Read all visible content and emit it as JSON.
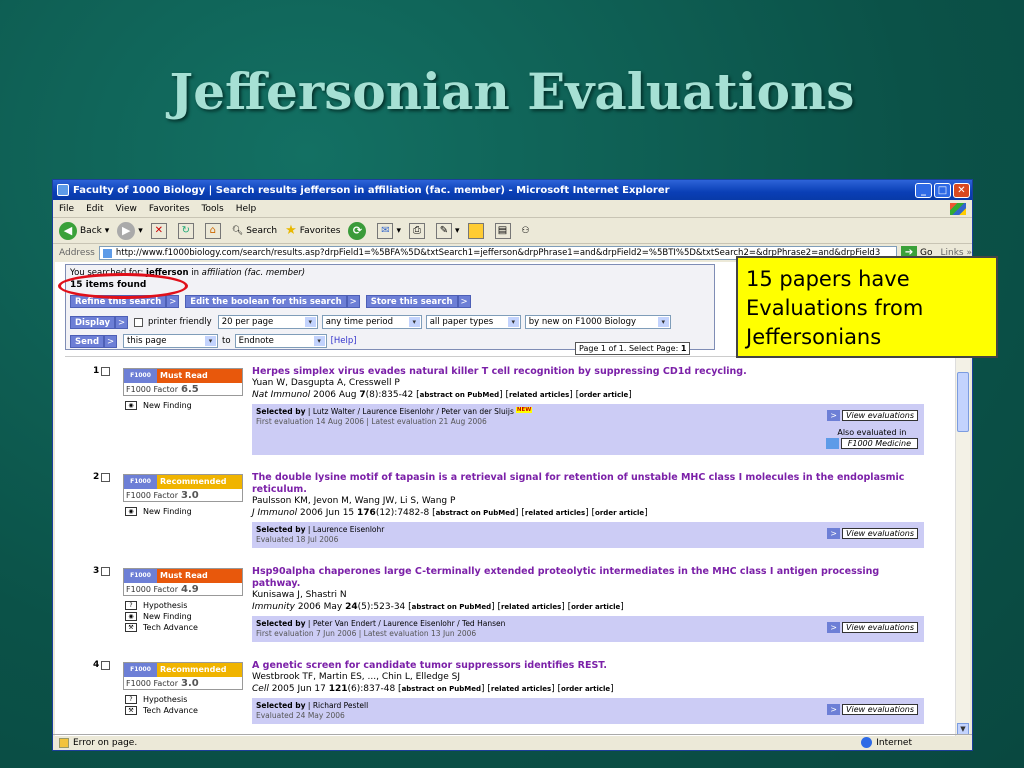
{
  "slide": {
    "title": "Jeffersonian Evaluations"
  },
  "callout": {
    "text": "15 papers have Evaluations from Jeffersonians"
  },
  "browser": {
    "title": "Faculty of 1000 Biology | Search results jefferson in affiliation (fac. member) - Microsoft Internet Explorer",
    "menu": [
      "File",
      "Edit",
      "View",
      "Favorites",
      "Tools",
      "Help"
    ],
    "toolbar": {
      "back": "Back",
      "search": "Search",
      "favorites": "Favorites"
    },
    "address_label": "Address",
    "url": "http://www.f1000biology.com/search/results.asp?drpField1=%5BFA%5D&txtSearch1=jefferson&drpPhrase1=and&drpField2=%5BTI%5D&txtSearch2=&drpPhrase2=and&drpField3",
    "go": "Go",
    "links": "Links",
    "status": "Error on page.",
    "zone": "Internet"
  },
  "search": {
    "searched_prefix": "You searched for:",
    "term": "jefferson",
    "in_word": "in",
    "scope": "affiliation (fac. member)",
    "found": "15 items found",
    "refine": "Refine this search",
    "edit_boolean": "Edit the boolean for this search",
    "store": "Store this search",
    "display_btn": "Display",
    "printer_friendly": "printer friendly",
    "per_page": "20 per page",
    "time_period": "any time period",
    "paper_types": "all paper types",
    "sort": "by new on F1000 Biology",
    "send_btn": "Send",
    "send_scope": "this page",
    "to_word": "to",
    "send_target": "Endnote",
    "help": "[Help]",
    "page_info": "Page 1 of 1. Select Page:",
    "page_num": "1"
  },
  "results": [
    {
      "num": "1",
      "rating": "Must Read",
      "rating_color": "#e8580c",
      "factor_label": "F1000 Factor",
      "factor": "6.5",
      "tags": [
        {
          "icon": "eye-icon",
          "label": "New Finding"
        }
      ],
      "title": "Herpes simplex virus evades natural killer T cell recognition by suppressing CD1d recycling.",
      "authors": "Yuan W, Dasgupta A, Cresswell P",
      "journal": "Nat Immunol",
      "citation_pre": "2006 Aug",
      "volume": "7",
      "citation_post": "(8):835-42",
      "selected_label": "Selected by",
      "selectors": "| Lutz Walter / Laurence Eisenlohr / Peter van der Sluijs",
      "eval_dates": "First evaluation 14 Aug 2006 | Latest evaluation 21 Aug 2006",
      "also_label": "Also evaluated in",
      "also_target": "F1000 Medicine"
    },
    {
      "num": "2",
      "rating": "Recommended",
      "rating_color": "#f0b400",
      "factor_label": "F1000 Factor",
      "factor": "3.0",
      "tags": [
        {
          "icon": "eye-icon",
          "label": "New Finding"
        }
      ],
      "title": "The double lysine motif of tapasin is a retrieval signal for retention of unstable MHC class I molecules in the endoplasmic reticulum.",
      "authors": "Paulsson KM, Jevon M, Wang JW, Li S, Wang P",
      "journal": "J Immunol",
      "citation_pre": "2006 Jun 15",
      "volume": "176",
      "citation_post": "(12):7482-8",
      "selected_label": "Selected by",
      "selectors": "| Laurence Eisenlohr",
      "eval_dates": "Evaluated 18 Jul 2006"
    },
    {
      "num": "3",
      "rating": "Must Read",
      "rating_color": "#e8580c",
      "factor_label": "F1000 Factor",
      "factor": "4.9",
      "tags": [
        {
          "icon": "bulb-icon",
          "label": "Hypothesis"
        },
        {
          "icon": "eye-icon",
          "label": "New Finding"
        },
        {
          "icon": "tool-icon",
          "label": "Tech Advance"
        }
      ],
      "title": "Hsp90alpha chaperones large C-terminally extended proteolytic intermediates in the MHC class I antigen processing pathway.",
      "authors": "Kunisawa J, Shastri N",
      "journal": "Immunity",
      "citation_pre": "2006 May",
      "volume": "24",
      "citation_post": "(5):523-34",
      "selected_label": "Selected by",
      "selectors": "| Peter Van Endert / Laurence Eisenlohr / Ted Hansen",
      "eval_dates": "First evaluation 7 Jun 2006 | Latest evaluation 13 Jun 2006"
    },
    {
      "num": "4",
      "rating": "Recommended",
      "rating_color": "#f0b400",
      "factor_label": "F1000 Factor",
      "factor": "3.0",
      "tags": [
        {
          "icon": "bulb-icon",
          "label": "Hypothesis"
        },
        {
          "icon": "tool-icon",
          "label": "Tech Advance"
        }
      ],
      "title": "A genetic screen for candidate tumor suppressors identifies REST.",
      "authors": "Westbrook TF, Martin ES, ..., Chin L, Elledge SJ",
      "journal": "Cell",
      "citation_pre": "2005 Jun 17",
      "volume": "121",
      "citation_post": "(6):837-48",
      "selected_label": "Selected by",
      "selectors": "| Richard Pestell",
      "eval_dates": "Evaluated 24 May 2006"
    }
  ],
  "links": {
    "abstract": "abstract on PubMed",
    "related": "related articles",
    "order": "order article",
    "view_eval": "View evaluations",
    "new_badge": "NEW",
    "logo": "F1000"
  }
}
